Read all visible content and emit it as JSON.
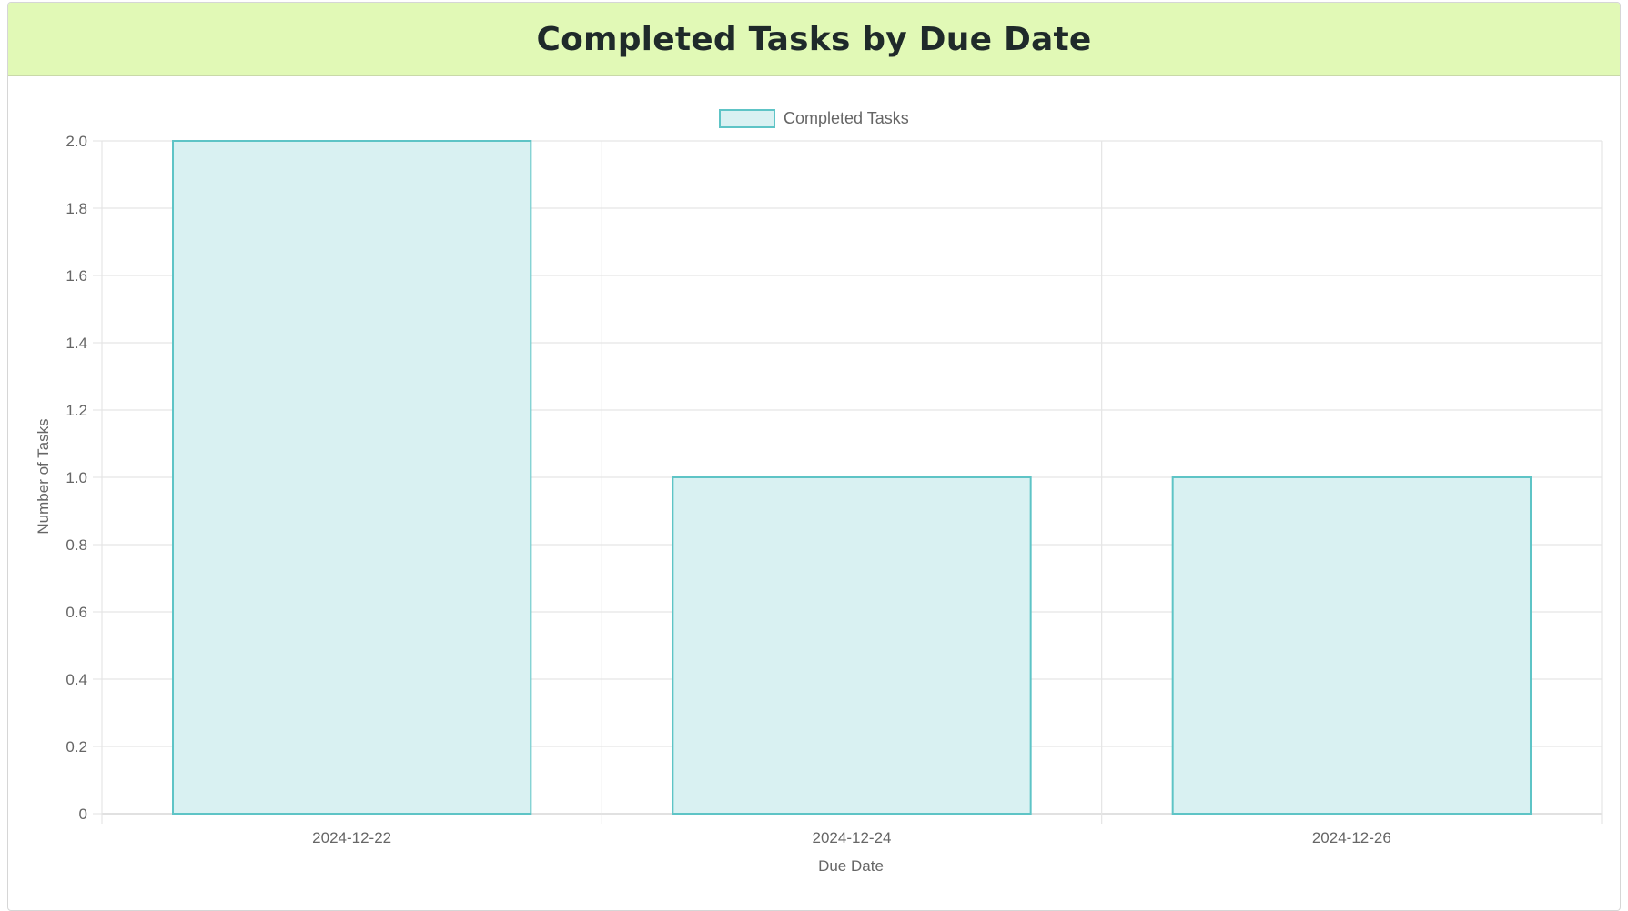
{
  "header": {
    "title": "Completed Tasks by Due Date"
  },
  "colors": {
    "header_bg": "#e1f9b6",
    "bar_fill": "#d9f1f2",
    "bar_border": "#5ec4c6",
    "grid": "#e5e5e5",
    "text": "#666666"
  },
  "chart_data": {
    "type": "bar",
    "categories": [
      "2024-12-22",
      "2024-12-24",
      "2024-12-26"
    ],
    "series": [
      {
        "name": "Completed Tasks",
        "values": [
          2,
          1,
          1
        ]
      }
    ],
    "xlabel": "Due Date",
    "ylabel": "Number of Tasks",
    "ylim": [
      0,
      2
    ],
    "yticks": [
      "0",
      "0.2",
      "0.4",
      "0.6",
      "0.8",
      "1.0",
      "1.2",
      "1.4",
      "1.6",
      "1.8",
      "2.0"
    ],
    "grid": true,
    "legend_position": "top-center"
  }
}
